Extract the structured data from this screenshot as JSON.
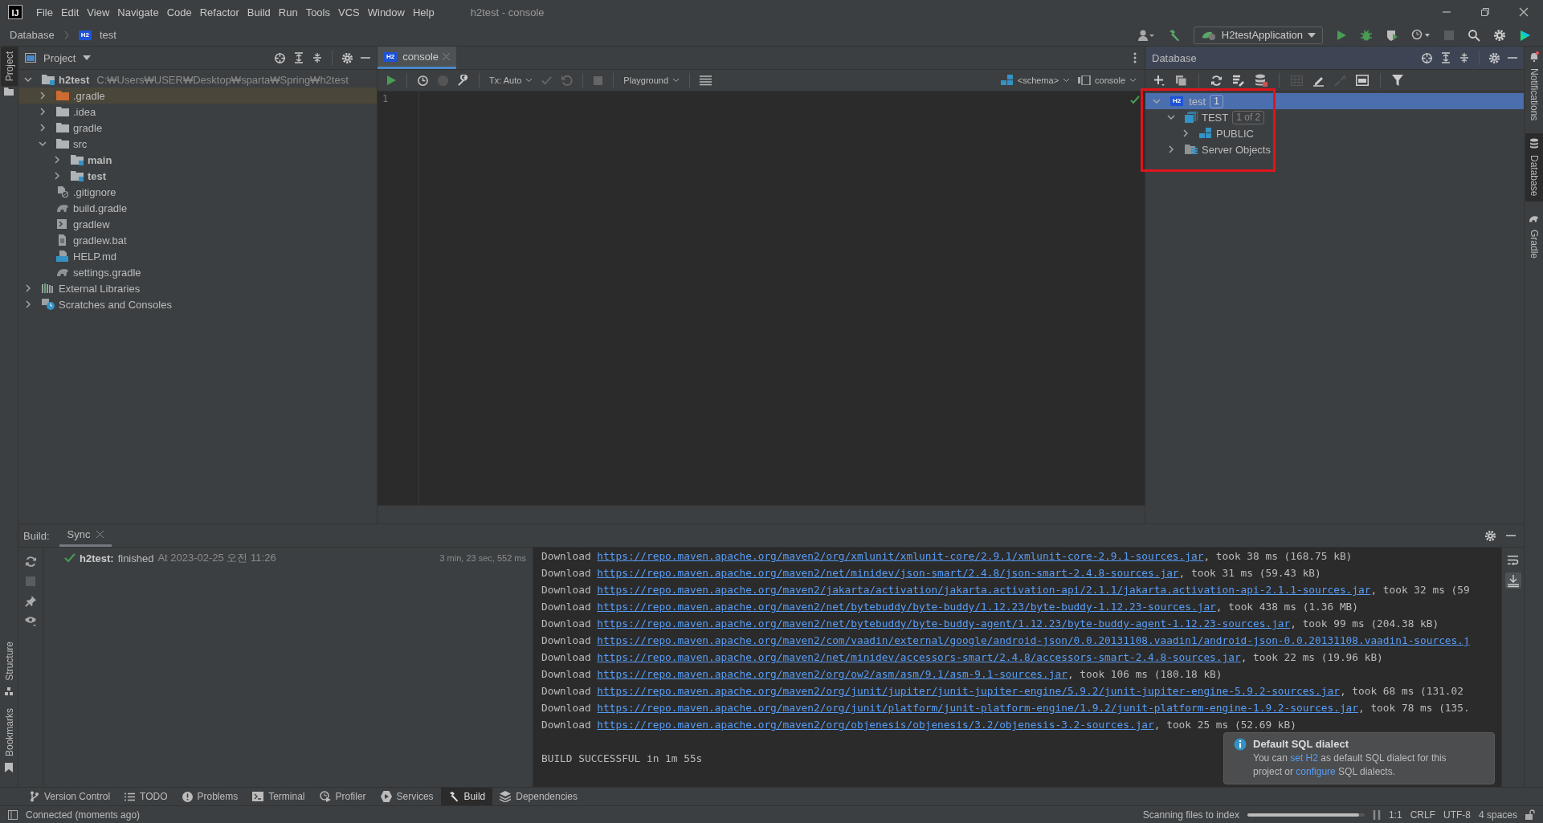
{
  "menu_bar": {
    "logo": "IJ",
    "items": [
      "File",
      "Edit",
      "View",
      "Navigate",
      "Code",
      "Refactor",
      "Build",
      "Run",
      "Tools",
      "VCS",
      "Window",
      "Help"
    ],
    "title": "h2test - console"
  },
  "breadcrumb": [
    {
      "label": "Database"
    },
    {
      "badge": "H2",
      "label": "test"
    }
  ],
  "run_config": {
    "label": "H2testApplication"
  },
  "left_stripe": {
    "top": [
      {
        "label": "Project",
        "selected": true
      }
    ],
    "bottom": [
      {
        "label": "Structure",
        "selected": false
      },
      {
        "label": "Bookmarks",
        "selected": false
      }
    ]
  },
  "project_panel": {
    "title": "Project",
    "tree": [
      {
        "label": "h2test",
        "detail": "C:₩Users₩USER₩Desktop₩sparta₩Spring₩h2test",
        "kind": "project",
        "expanded": true,
        "selected": false,
        "children": [
          {
            "label": ".gradle",
            "kind": "excluded-folder",
            "expanded": false,
            "selected": true
          },
          {
            "label": ".idea",
            "kind": "folder",
            "expanded": false,
            "selected": false
          },
          {
            "label": "gradle",
            "kind": "folder",
            "expanded": false,
            "selected": false
          },
          {
            "label": "src",
            "kind": "folder",
            "expanded": true,
            "selected": false,
            "children": [
              {
                "label": "main",
                "kind": "source-folder",
                "expanded": false,
                "selected": false
              },
              {
                "label": "test",
                "kind": "source-folder",
                "expanded": false,
                "selected": false
              }
            ]
          },
          {
            "label": ".gitignore",
            "kind": "ignore-file",
            "selected": false
          },
          {
            "label": "build.gradle",
            "kind": "gradle-file",
            "selected": false
          },
          {
            "label": "gradlew",
            "kind": "script-file",
            "selected": false
          },
          {
            "label": "gradlew.bat",
            "kind": "text-file",
            "selected": false
          },
          {
            "label": "HELP.md",
            "kind": "markdown-file",
            "selected": false
          },
          {
            "label": "settings.gradle",
            "kind": "gradle-file",
            "selected": false
          }
        ]
      },
      {
        "label": "External Libraries",
        "kind": "libraries",
        "expanded": false,
        "selected": false
      },
      {
        "label": "Scratches and Consoles",
        "kind": "scratches",
        "expanded": false,
        "selected": false
      }
    ]
  },
  "editor": {
    "tabs": [
      {
        "badge": "H2",
        "label": "console",
        "selected": true
      }
    ],
    "tx_mode": "Tx: Auto",
    "mode": "Playground",
    "schema": "<schema>",
    "session": "console",
    "line_numbers": [
      "1"
    ]
  },
  "database_panel": {
    "title": "Database",
    "tree": [
      {
        "badge": "H2",
        "label": "test",
        "count": "1",
        "kind": "datasource",
        "expanded": true,
        "selected": true,
        "children": [
          {
            "label": "TEST",
            "count": "1 of 2",
            "kind": "database",
            "expanded": true,
            "selected": false,
            "children": [
              {
                "label": "PUBLIC",
                "kind": "schema",
                "expanded": false,
                "selected": false
              }
            ]
          },
          {
            "label": "Server Objects",
            "kind": "server-objects",
            "expanded": false,
            "selected": false
          }
        ]
      }
    ]
  },
  "right_stripe": [
    {
      "label": "Notifications",
      "kind": "bell",
      "selected": false
    },
    {
      "label": "Database",
      "kind": "database",
      "selected": true
    },
    {
      "label": "Gradle",
      "kind": "elephant",
      "selected": false
    }
  ],
  "build_panel": {
    "label": "Build:",
    "tabs": [
      {
        "label": "Sync",
        "selected": true
      }
    ],
    "tree": [
      {
        "name": "h2test:",
        "status": "finished",
        "time": "At 2023-02-25 오전 11:26",
        "duration": "3 min, 23 sec, 552 ms"
      }
    ],
    "log": [
      {
        "kind": "download",
        "prefix": "Download",
        "url": "https://repo.maven.apache.org/maven2/org/xmlunit/xmlunit-core/2.9.1/xmlunit-core-2.9.1-sources.jar",
        "suffix": ", took 38 ms (168.75 kB)"
      },
      {
        "kind": "download",
        "prefix": "Download",
        "url": "https://repo.maven.apache.org/maven2/net/minidev/json-smart/2.4.8/json-smart-2.4.8-sources.jar",
        "suffix": ", took 31 ms (59.43 kB)"
      },
      {
        "kind": "download",
        "prefix": "Download",
        "url": "https://repo.maven.apache.org/maven2/jakarta/activation/jakarta.activation-api/2.1.1/jakarta.activation-api-2.1.1-sources.jar",
        "suffix": ", took 32 ms (59"
      },
      {
        "kind": "download",
        "prefix": "Download",
        "url": "https://repo.maven.apache.org/maven2/net/bytebuddy/byte-buddy/1.12.23/byte-buddy-1.12.23-sources.jar",
        "suffix": ", took 438 ms (1.36 MB)"
      },
      {
        "kind": "download",
        "prefix": "Download",
        "url": "https://repo.maven.apache.org/maven2/net/bytebuddy/byte-buddy-agent/1.12.23/byte-buddy-agent-1.12.23-sources.jar",
        "suffix": ", took 99 ms (204.38 kB)"
      },
      {
        "kind": "download",
        "prefix": "Download",
        "url": "https://repo.maven.apache.org/maven2/com/vaadin/external/google/android-json/0.0.20131108.vaadin1/android-json-0.0.20131108.vaadin1-sources.j"
      },
      {
        "kind": "download",
        "prefix": "Download",
        "url": "https://repo.maven.apache.org/maven2/net/minidev/accessors-smart/2.4.8/accessors-smart-2.4.8-sources.jar",
        "suffix": ", took 22 ms (19.96 kB)"
      },
      {
        "kind": "download",
        "prefix": "Download",
        "url": "https://repo.maven.apache.org/maven2/org/ow2/asm/asm/9.1/asm-9.1-sources.jar",
        "suffix": ", took 106 ms (180.18 kB)"
      },
      {
        "kind": "download",
        "prefix": "Download",
        "url": "https://repo.maven.apache.org/maven2/org/junit/jupiter/junit-jupiter-engine/5.9.2/junit-jupiter-engine-5.9.2-sources.jar",
        "suffix": ", took 68 ms (131.02"
      },
      {
        "kind": "download",
        "prefix": "Download",
        "url": "https://repo.maven.apache.org/maven2/org/junit/platform/junit-platform-engine/1.9.2/junit-platform-engine-1.9.2-sources.jar",
        "suffix": ", took 78 ms (135."
      },
      {
        "kind": "download",
        "prefix": "Download",
        "url": "https://repo.maven.apache.org/maven2/org/objenesis/objenesis/3.2/objenesis-3.2-sources.jar",
        "suffix": ", took 25 ms (52.69 kB)"
      },
      {
        "kind": "blank"
      },
      {
        "kind": "text",
        "text": "BUILD SUCCESSFUL in 1m 55s"
      }
    ]
  },
  "notification": {
    "title": "Default SQL dialect",
    "body": [
      {
        "kind": "text",
        "text": "You can "
      },
      {
        "kind": "link",
        "text": "set H2"
      },
      {
        "kind": "text",
        "text": " as default SQL dialect for this project or "
      },
      {
        "kind": "link",
        "text": "configure"
      },
      {
        "kind": "text",
        "text": " SQL dialects."
      }
    ]
  },
  "tool_tabs": [
    {
      "label": "Version Control",
      "kind": "vcs",
      "selected": false
    },
    {
      "label": "TODO",
      "kind": "list",
      "selected": false
    },
    {
      "label": "Problems",
      "kind": "problems",
      "selected": false
    },
    {
      "label": "Terminal",
      "kind": "terminal",
      "selected": false
    },
    {
      "label": "Profiler",
      "kind": "profiler",
      "selected": false
    },
    {
      "label": "Services",
      "kind": "services",
      "selected": false
    },
    {
      "label": "Build",
      "kind": "hammer",
      "selected": true
    },
    {
      "label": "Dependencies",
      "kind": "layers",
      "selected": false
    }
  ],
  "status_bar": {
    "message": "Connected (moments ago)",
    "task": "Scanning files to index",
    "progress": {
      "level": 0.95
    },
    "position": "1:1",
    "line_separator": "CRLF",
    "encoding": "UTF-8",
    "indent": "4 spaces"
  }
}
